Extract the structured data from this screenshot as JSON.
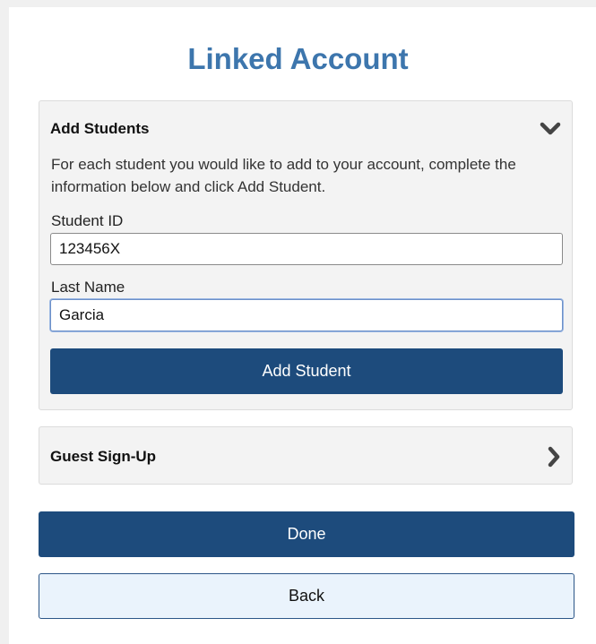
{
  "page": {
    "title": "Linked Account"
  },
  "add_students": {
    "header": "Add Students",
    "expanded": true,
    "chevron_icon": "chevron-down-icon",
    "description": "For each student you would like to add to your account, complete the information below and click Add Student.",
    "student_id_label": "Student ID",
    "student_id_value": "123456X",
    "last_name_label": "Last Name",
    "last_name_value": "Garcia",
    "add_button": "Add Student"
  },
  "guest_signup": {
    "header": "Guest Sign-Up",
    "expanded": false,
    "chevron_icon": "chevron-right-icon"
  },
  "actions": {
    "done_label": "Done",
    "back_label": "Back"
  },
  "colors": {
    "title": "#3d76ad",
    "primary": "#1d4b7c",
    "secondary_bg": "#eaf3fc",
    "panel_bg": "#f3f3f3",
    "focus_border": "#6c90c8"
  }
}
